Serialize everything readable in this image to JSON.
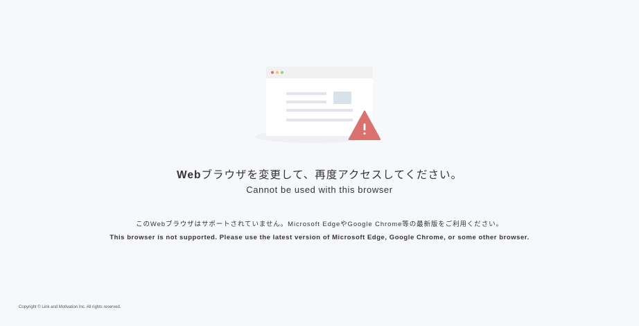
{
  "error": {
    "heading": "Webブラウザを変更して、再度アクセスしてください。",
    "subheading": "Cannot be used with this browser",
    "message_ja": "このWebブラウザはサポートされていません。Microsoft EdgeやGoogle Chrome等の最新版をご利用ください。",
    "message_en": "This browser is not supported. Please use the latest version of Microsoft Edge, Google Chrome, or some other browser."
  },
  "footer": {
    "copyright": "Copyright © Link and Motivation Inc. All rights reserved."
  },
  "illustration": {
    "icons": [
      "browser-window-icon",
      "warning-triangle-icon"
    ],
    "colors": {
      "background": "#f7f8fb",
      "window": "#ffffff",
      "titlebar": "#f1f1f1",
      "dot_red": "#e26a6a",
      "dot_yellow": "#f2c94c",
      "dot_green": "#8bd46b",
      "lines": "#e1e4ea",
      "image_block": "#d8e2e8",
      "warning": "#d9726e"
    }
  }
}
